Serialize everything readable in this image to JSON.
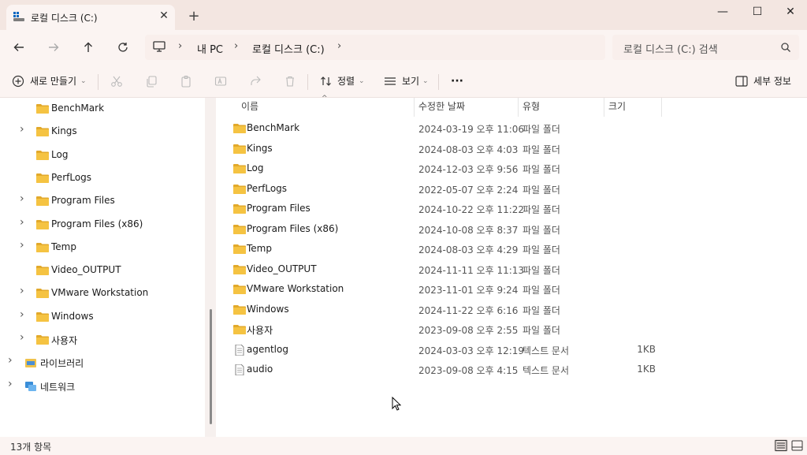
{
  "window": {
    "tab_title": "로컬 디스크 (C:)",
    "tab_close": "✕",
    "new_tab": "+",
    "minimize": "—",
    "maximize": "☐",
    "close": "✕"
  },
  "address": {
    "breadcrumbs": [
      "내 PC",
      "로컬 디스크 (C:)"
    ],
    "separator": "›",
    "search_placeholder": "로컬 디스크 (C:) 검색"
  },
  "commands": {
    "new": "새로 만들기",
    "sort": "정렬",
    "view": "보기",
    "more": "···",
    "details": "세부 정보"
  },
  "sidebar": {
    "items": [
      {
        "label": "BenchMark",
        "expandable": false,
        "icon": "folder-icon"
      },
      {
        "label": "Kings",
        "expandable": true,
        "icon": "folder-icon"
      },
      {
        "label": "Log",
        "expandable": false,
        "icon": "folder-icon"
      },
      {
        "label": "PerfLogs",
        "expandable": false,
        "icon": "folder-icon"
      },
      {
        "label": "Program Files",
        "expandable": true,
        "icon": "folder-icon"
      },
      {
        "label": "Program Files (x86)",
        "expandable": true,
        "icon": "folder-icon"
      },
      {
        "label": "Temp",
        "expandable": true,
        "icon": "folder-icon"
      },
      {
        "label": "Video_OUTPUT",
        "expandable": false,
        "icon": "folder-icon"
      },
      {
        "label": "VMware Workstation",
        "expandable": true,
        "icon": "folder-icon"
      },
      {
        "label": "Windows",
        "expandable": true,
        "icon": "folder-icon"
      },
      {
        "label": "사용자",
        "expandable": true,
        "icon": "folder-icon"
      },
      {
        "label": "라이브러리",
        "expandable": true,
        "icon": "library-icon"
      },
      {
        "label": "네트워크",
        "expandable": true,
        "icon": "network-icon"
      }
    ]
  },
  "columns": {
    "name": "이름",
    "date": "수정한 날짜",
    "type": "유형",
    "size": "크기"
  },
  "files": [
    {
      "name": "BenchMark",
      "date": "2024-03-19 오후 11:06",
      "type": "파일 폴더",
      "size": "",
      "icon": "folder-icon"
    },
    {
      "name": "Kings",
      "date": "2024-08-03 오후 4:03",
      "type": "파일 폴더",
      "size": "",
      "icon": "folder-icon"
    },
    {
      "name": "Log",
      "date": "2024-12-03 오후 9:56",
      "type": "파일 폴더",
      "size": "",
      "icon": "folder-icon"
    },
    {
      "name": "PerfLogs",
      "date": "2022-05-07 오후 2:24",
      "type": "파일 폴더",
      "size": "",
      "icon": "folder-icon"
    },
    {
      "name": "Program Files",
      "date": "2024-10-22 오후 11:22",
      "type": "파일 폴더",
      "size": "",
      "icon": "folder-icon"
    },
    {
      "name": "Program Files (x86)",
      "date": "2024-10-08 오후 8:37",
      "type": "파일 폴더",
      "size": "",
      "icon": "folder-icon"
    },
    {
      "name": "Temp",
      "date": "2024-08-03 오후 4:29",
      "type": "파일 폴더",
      "size": "",
      "icon": "folder-icon"
    },
    {
      "name": "Video_OUTPUT",
      "date": "2024-11-11 오후 11:13",
      "type": "파일 폴더",
      "size": "",
      "icon": "folder-icon"
    },
    {
      "name": "VMware Workstation",
      "date": "2023-11-01 오후 9:24",
      "type": "파일 폴더",
      "size": "",
      "icon": "folder-icon"
    },
    {
      "name": "Windows",
      "date": "2024-11-22 오후 6:16",
      "type": "파일 폴더",
      "size": "",
      "icon": "folder-icon"
    },
    {
      "name": "사용자",
      "date": "2023-09-08 오후 2:55",
      "type": "파일 폴더",
      "size": "",
      "icon": "folder-icon"
    },
    {
      "name": "agentlog",
      "date": "2024-03-03 오후 12:19",
      "type": "텍스트 문서",
      "size": "1KB",
      "icon": "text-file-icon"
    },
    {
      "name": "audio",
      "date": "2023-09-08 오후 4:15",
      "type": "텍스트 문서",
      "size": "1KB",
      "icon": "text-file-icon"
    }
  ],
  "status": {
    "item_count": "13개 항목"
  },
  "colors": {
    "folder": "#f5c342",
    "folder_dark": "#e2a92b",
    "chrome_bg": "#f3e6e1",
    "accent": "#0067c0"
  }
}
